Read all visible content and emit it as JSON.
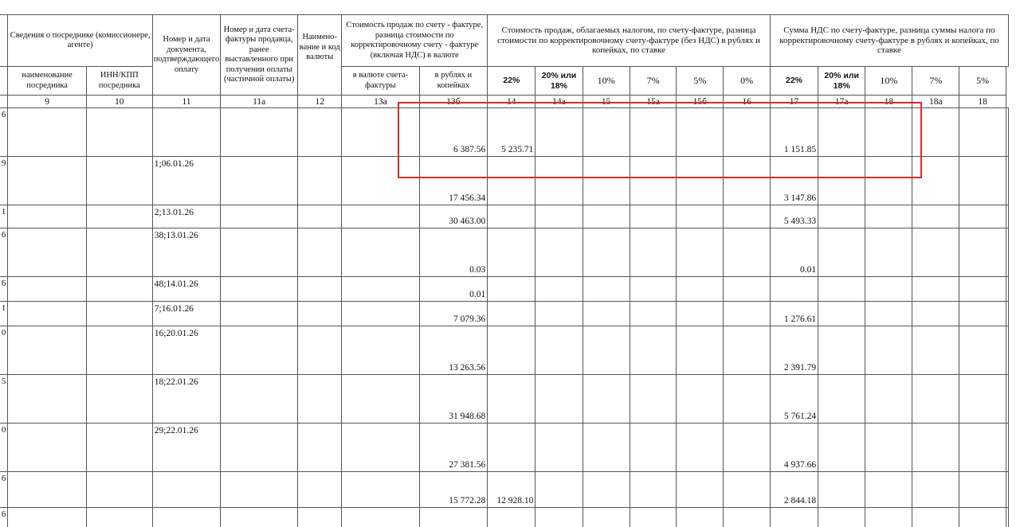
{
  "header": {
    "agent_group": "Сведения о посреднике (комиссионере, агенте)",
    "agent_name": "наименование посредника",
    "agent_inn": "ИНН/КПП посредника",
    "payment_doc": "Номер и дата документа, подтверждающего оплату",
    "prepaid_invoice": "Номер и дата счета-фактуры продавца, ранее выставленного при получении оплаты (частичной оплаты)",
    "currency": "Наимено-вание и код валюты",
    "sales_total_group": "Стоимость продаж по счету - фактуре, разница стоимости по корректировочному счету - фактуре (включая НДС) в валюте",
    "in_currency": "в валюте счета-фактуры",
    "in_rubles": "в рублях и копейках",
    "taxable_group": "Стоимость продаж, облагаемых налогом, по счету-фактуре, разница стоимости по корректировочному счету-фактуре (без НДС) в рублях и копейках, по ставке",
    "vat_group": "Сумма НДС по счету-фактуре, разница суммы налога по корректировочному счету-фактуре в рублях и копейках, по ставке",
    "rates": {
      "r22": "22%",
      "r20_18": "20% или 18%",
      "r10": "10%",
      "r7": "7%",
      "r5": "5%",
      "r0": "0%"
    }
  },
  "column_numbers": [
    "9",
    "10",
    "11",
    "11а",
    "12",
    "13а",
    "13б",
    "14",
    "14а",
    "15",
    "15а",
    "15б",
    "16",
    "17",
    "17а",
    "18",
    "18а",
    "18"
  ],
  "rows": [
    {
      "id": "6",
      "doc": "",
      "rub": "6 387.56",
      "s22": "5 235.71",
      "v22": "1 151.85"
    },
    {
      "id": "9",
      "doc": "1;06.01.26",
      "rub": "17 456.34",
      "s22": "",
      "v22": "3 147.86"
    },
    {
      "id": "1",
      "doc": "2;13.01.26",
      "rub": "30 463.00",
      "s22": "",
      "v22": "5 493.33"
    },
    {
      "id": "6",
      "doc": "38;13.01.26",
      "rub": "0.03",
      "s22": "",
      "v22": "0.01"
    },
    {
      "id": "6",
      "doc": "48;14.01.26",
      "rub": "0.01",
      "s22": "",
      "v22": ""
    },
    {
      "id": "1",
      "doc": "7;16.01.26",
      "rub": "7 079.36",
      "s22": "",
      "v22": "1 276.61"
    },
    {
      "id": "0",
      "doc": "16;20.01.26",
      "rub": "13 263.56",
      "s22": "",
      "v22": "2 391.79"
    },
    {
      "id": "5",
      "doc": "18;22.01.26",
      "rub": "31 948.68",
      "s22": "",
      "v22": "5 761.24"
    },
    {
      "id": "0",
      "doc": "29;22.01.26",
      "rub": "27 381.56",
      "s22": "",
      "v22": "4 937.66"
    },
    {
      "id": "6",
      "doc": "",
      "rub": "15 772.28",
      "s22": "12 928.10",
      "v22": "2 844.18"
    },
    {
      "id": "6",
      "doc": "",
      "rub": "",
      "s22": "",
      "v22": ""
    }
  ],
  "colors": {
    "grid": "#555555",
    "highlight": "#dd2b2b"
  }
}
